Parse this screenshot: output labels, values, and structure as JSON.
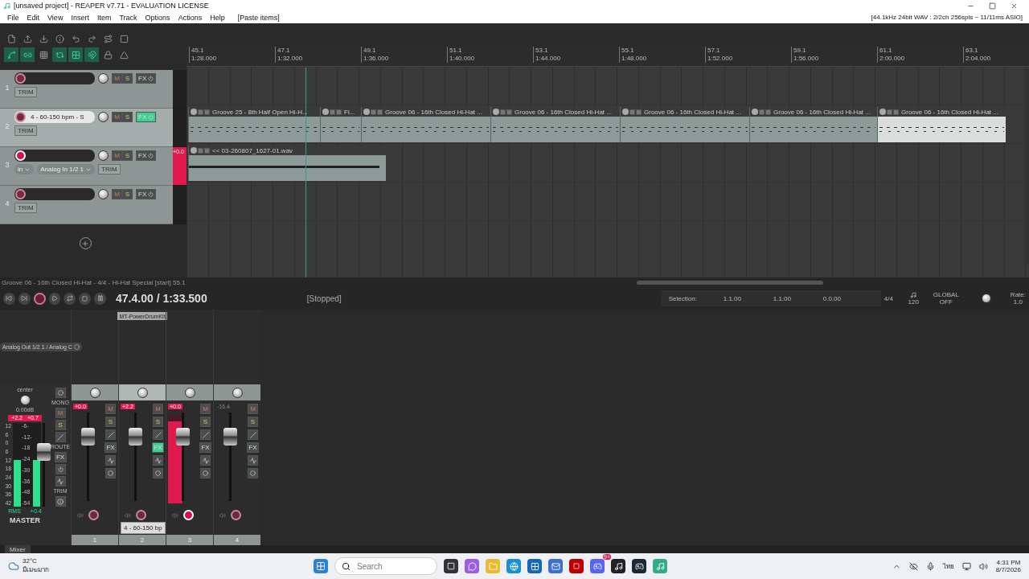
{
  "window": {
    "title": "[unsaved project] - REAPER v7.71 - EVALUATION LICENSE"
  },
  "menu": [
    "File",
    "Edit",
    "View",
    "Insert",
    "Item",
    "Track",
    "Options",
    "Actions",
    "Help"
  ],
  "last_action": "[Paste items]",
  "audio_info": "[44.1kHz 24bit WAV : 2/2ch 256spls ~ 11/11ms ASIO]",
  "toolbar": [
    {
      "on": false
    },
    {
      "on": false
    },
    {
      "on": false
    },
    {
      "on": false
    },
    {
      "on": false
    },
    {
      "on": false
    },
    {
      "on": false
    },
    {
      "on": false
    },
    {
      "on": true
    },
    {
      "on": true
    },
    {
      "on": false
    },
    {
      "on": true
    },
    {
      "on": true
    },
    {
      "on": true
    },
    {
      "on": false
    },
    {
      "on": false
    }
  ],
  "ruler": [
    {
      "measure": "45.1",
      "time": "1:28.000"
    },
    {
      "measure": "47.1",
      "time": "1:32.000"
    },
    {
      "measure": "49.1",
      "time": "1:36.000"
    },
    {
      "measure": "51.1",
      "time": "1:40.000"
    },
    {
      "measure": "53.1",
      "time": "1:44.000"
    },
    {
      "measure": "55.1",
      "time": "1:48.000"
    },
    {
      "measure": "57.1",
      "time": "1:52.000"
    },
    {
      "measure": "59.1",
      "time": "1:56.000"
    },
    {
      "measure": "61.1",
      "time": "2:00.000"
    },
    {
      "measure": "63.1",
      "time": "2:04.000"
    }
  ],
  "tracks": [
    {
      "number": "1",
      "selected": false,
      "armed": false,
      "mute": "M",
      "solo": "S",
      "fx": "FX",
      "fx_active": false,
      "meter": {
        "level": 0
      },
      "trim": "TRIM"
    },
    {
      "number": "2",
      "name": "4 - 60-150 bpm - S",
      "selected": true,
      "armed": false,
      "mute": "M",
      "solo": "S",
      "fx": "FX",
      "fx_active": true,
      "meter": {
        "level": 0
      },
      "trim": "TRIM",
      "items": [
        {
          "kind": "midi",
          "label": "Groove 25 - 8th Half Open Hi-H...",
          "selected": false
        },
        {
          "kind": "midi",
          "label": "Fi...",
          "selected": false
        },
        {
          "kind": "midi",
          "label": "Groove 06 - 16th Closed Hi-Hat ...",
          "selected": false
        },
        {
          "kind": "midi",
          "label": "Groove 06 - 16th Closed Hi-Hat ...",
          "selected": false
        },
        {
          "kind": "midi",
          "label": "Groove 06 - 16th Closed Hi-Hat ...",
          "selected": false
        },
        {
          "kind": "midi",
          "label": "Groove 06 - 16th Closed Hi-Hat ...",
          "selected": false
        },
        {
          "kind": "midi",
          "label": "Groove 06 - 16th Closed Hi-Hat ...",
          "selected": true
        }
      ]
    },
    {
      "number": "3",
      "selected": false,
      "armed": true,
      "mute": "M",
      "solo": "S",
      "fx": "FX",
      "fx_active": false,
      "meter": {
        "level": 1
      },
      "peak": "+0.0",
      "input_mode": "in",
      "input": "Analog In 1/2 1",
      "trim": "TRIM",
      "items": [
        {
          "kind": "audio",
          "label": "<< 03-260807_1627-01.wav",
          "selected": false
        }
      ]
    },
    {
      "number": "4",
      "selected": false,
      "armed": false,
      "mute": "M",
      "solo": "S",
      "fx": "FX",
      "fx_active": false,
      "meter": {
        "level": 0
      },
      "trim": "TRIM"
    }
  ],
  "status_line": "Groove 06 - 16th Closed Hi-Hat - 4/4 - Hi-Hat Special [start] 55.1",
  "transport": {
    "position": "47.4.00 / 1:33.500",
    "state": "[Stopped]",
    "playing": false,
    "selection_label": "Selection:",
    "selection": [
      "1.1.00",
      "1.1.00",
      "0.0.00"
    ],
    "time_signature": "4/4",
    "tempo": "120",
    "global_label": "GLOBAL",
    "global_value": "OFF",
    "rate_label": "Rate:",
    "rate": "1.0"
  },
  "mixer": {
    "tab": "Mixer",
    "master": {
      "output": "Analog Out 1/2 1 / Analog C",
      "pan": "center",
      "volume": "0.00dB",
      "peak_left": "+2.2",
      "peak_right": "+0.7",
      "scale_side": [
        "12",
        "6",
        "0",
        "6",
        "12",
        "18",
        "24",
        "30",
        "36",
        "42"
      ],
      "scale_mid": [
        "-6-",
        "-12-",
        "-18",
        "-24",
        "-30",
        "-36",
        "-48",
        "-54"
      ],
      "mode": "RMS",
      "reading": "+0.4",
      "name": "MASTER",
      "mono": "MONO",
      "mute": "M",
      "solo": "S",
      "route": "ROUTE",
      "fx": "FX",
      "trim": "TRIM",
      "meter": {
        "level": 0.56
      },
      "fader": {
        "level": 0.7
      }
    },
    "channels": [
      {
        "number": "1",
        "volume": "+0.0",
        "clipped": true,
        "selected": false,
        "armed": false,
        "mute": "M",
        "solo": "S",
        "fx_label": "FX",
        "fx_active": false,
        "meter": {
          "level": 0
        },
        "fader": {
          "level": 0.78
        }
      },
      {
        "number": "2",
        "volume": "+2.2",
        "clipped": true,
        "selected": true,
        "armed": false,
        "mute": "M",
        "solo": "S",
        "fx_label": "FX",
        "fx": "MT-PowerDrumKit",
        "fx_active": true,
        "meter": {
          "level": 0
        },
        "fader": {
          "level": 0.78
        }
      },
      {
        "number": "3",
        "volume": "+0.0",
        "clipped": true,
        "selected": false,
        "armed": true,
        "mute": "M",
        "solo": "S",
        "fx_label": "FX",
        "fx_active": false,
        "meter": {
          "level": 0.93
        },
        "fader": {
          "level": 0.78
        }
      },
      {
        "number": "4",
        "volume": "-16.4",
        "clipped": false,
        "selected": false,
        "armed": false,
        "mute": "M",
        "solo": "S",
        "fx_label": "FX",
        "fx_active": false,
        "meter": {
          "level": 0
        },
        "fader": {
          "level": 0.78
        }
      }
    ],
    "tooltip": "4 - 60-150 bp"
  },
  "taskbar": {
    "temperature": "32°C",
    "weather": "มีเมฆมาก",
    "search_placeholder": "Search",
    "language": "ไทย",
    "time": "4:31 PM",
    "date": "8/7/2026",
    "badge": "9+"
  }
}
